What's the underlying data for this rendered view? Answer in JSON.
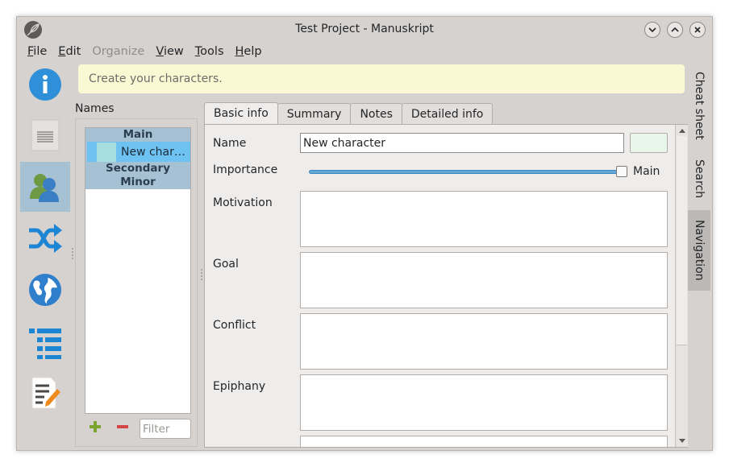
{
  "window": {
    "title": "Test Project - Manuskript"
  },
  "menubar": [
    {
      "underline": "F",
      "rest": "ile",
      "disabled": false
    },
    {
      "underline": "E",
      "rest": "dit",
      "disabled": false
    },
    {
      "underline": "",
      "rest": "Organize",
      "disabled": true
    },
    {
      "underline": "V",
      "rest": "iew",
      "disabled": false
    },
    {
      "underline": "T",
      "rest": "ools",
      "disabled": false
    },
    {
      "underline": "H",
      "rest": "elp",
      "disabled": false
    }
  ],
  "sidebar_tools": [
    "info-icon",
    "outline-page-icon",
    "characters-icon",
    "shuffle-icon",
    "globe-icon",
    "tree-list-icon",
    "editor-pencil-icon"
  ],
  "hint": {
    "text": "Create your characters."
  },
  "names": {
    "label": "Names",
    "groups": {
      "main": "Main",
      "secondary": "Secondary",
      "minor": "Minor"
    },
    "characters": [
      {
        "name": "New char…",
        "swatch": "#a8dede"
      }
    ],
    "filter_placeholder": "Filter"
  },
  "tabs": [
    "Basic info",
    "Summary",
    "Notes",
    "Detailed info"
  ],
  "basic_info": {
    "name_label": "Name",
    "name_value": "New character",
    "importance_label": "Importance",
    "importance_value": "Main",
    "importance_level": 1.0,
    "motivation_label": "Motivation",
    "goal_label": "Goal",
    "conflict_label": "Conflict",
    "epiphany_label": "Epiphany"
  },
  "dock_tabs": [
    "Cheat sheet",
    "Search",
    "Navigation"
  ],
  "colors": {
    "accent": "#a7c1d4",
    "selection": "#6ec2f2",
    "hint_bg": "#fbf8d4",
    "slider": "#61a7d9"
  }
}
